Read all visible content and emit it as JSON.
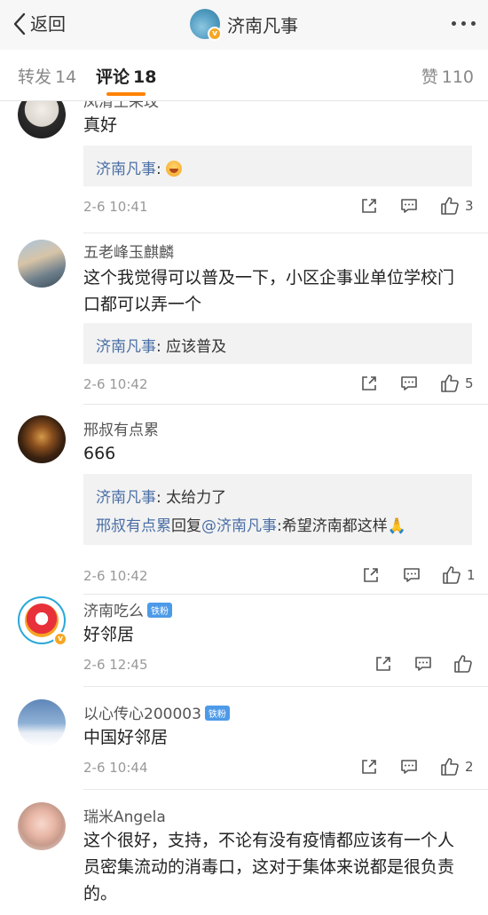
{
  "header": {
    "back_label": "返回",
    "title": "济南凡事"
  },
  "tabs": {
    "forward": {
      "label": "转发",
      "count": "14"
    },
    "comment": {
      "label": "评论",
      "count": "18"
    },
    "like": {
      "label": "赞",
      "count": "110"
    }
  },
  "comments": [
    {
      "name": "凤清王采玟",
      "text": "真好",
      "replies": [
        {
          "name": "济南凡事",
          "sep": ": ",
          "text": ""
        }
      ],
      "time": "2-6 10:41",
      "like_count": "3"
    },
    {
      "name": "五老峰玉麒麟",
      "text_line1": "这个我觉得可以普及一下，小区企事业单位学校门",
      "text_line2": "口都可以弄一个",
      "replies": [
        {
          "name": "济南凡事",
          "sep": ": ",
          "text": "应该普及"
        }
      ],
      "time": "2-6 10:42",
      "like_count": "5"
    },
    {
      "name": "邢叔有点累",
      "text": "666",
      "replies": [
        {
          "name": "济南凡事",
          "sep": ": ",
          "text": "太给力了"
        },
        {
          "name": "邢叔有点累",
          "mid": "回复",
          "at": "@济南凡事",
          "text": ":希望济南都这样🙏"
        }
      ],
      "time": "2-6 10:42",
      "like_count": "1"
    },
    {
      "name": "济南吃么",
      "badge": "铁粉",
      "text": "好邻居",
      "time": "2-6 12:45",
      "like_count": ""
    },
    {
      "name": "以心传心200003",
      "badge": "铁粉",
      "text": "中国好邻居",
      "time": "2-6 10:44",
      "like_count": "2"
    },
    {
      "name": "瑞米Angela",
      "text_line1": "这个很好，支持，不论有没有疫情都应该有一个人",
      "text_line2": "员密集流动的消毒口，这对于集体来说都是很负责",
      "text_line3": "的。"
    }
  ],
  "colors": {
    "accent": "#ff8200",
    "link": "#4a6fa5",
    "reply_bg": "#f2f2f2"
  },
  "icons": [
    "chevron-left-icon",
    "more-icon",
    "share-icon",
    "comment-icon",
    "thumb-up-icon",
    "verified-icon",
    "laugh-emoji-icon"
  ]
}
